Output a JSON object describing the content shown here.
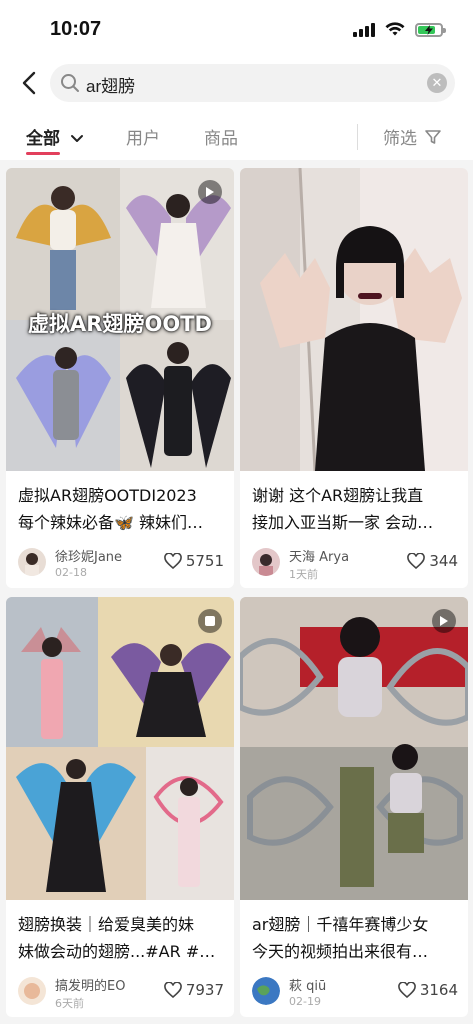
{
  "status": {
    "time": "10:07",
    "battery_level": 0.7
  },
  "search": {
    "query": "ar翅膀"
  },
  "tabs": {
    "all": "全部",
    "users": "用户",
    "products": "商品",
    "filter": "筛选"
  },
  "posts": [
    {
      "title_line1": "虚拟AR翅膀OOTDI2023",
      "title_line2": "每个辣妹必备🦋 辣妹们…",
      "author": "徐珍妮Jane",
      "date": "02-18",
      "likes": "5751",
      "overlay": "虚拟AR翅膀OOTD"
    },
    {
      "title_line1": "谢谢 这个AR翅膀让我直",
      "title_line2": "接加入亚当斯一家 会动…",
      "author": "天海 Arya",
      "date": "1天前",
      "likes": "344"
    },
    {
      "title_line1": "翅膀换装｜给爱臭美的妹",
      "title_line2": "妹做会动的翅膀...#AR #…",
      "author": "搞发明的EO",
      "date": "6天前",
      "likes": "7937"
    },
    {
      "title_line1": "ar翅膀｜千禧年赛博少女",
      "title_line2": "今天的视频拍出来很有…",
      "author": "萩 qiū",
      "date": "02-19",
      "likes": "3164"
    }
  ],
  "colors": {
    "accent": "#e23f5c"
  }
}
